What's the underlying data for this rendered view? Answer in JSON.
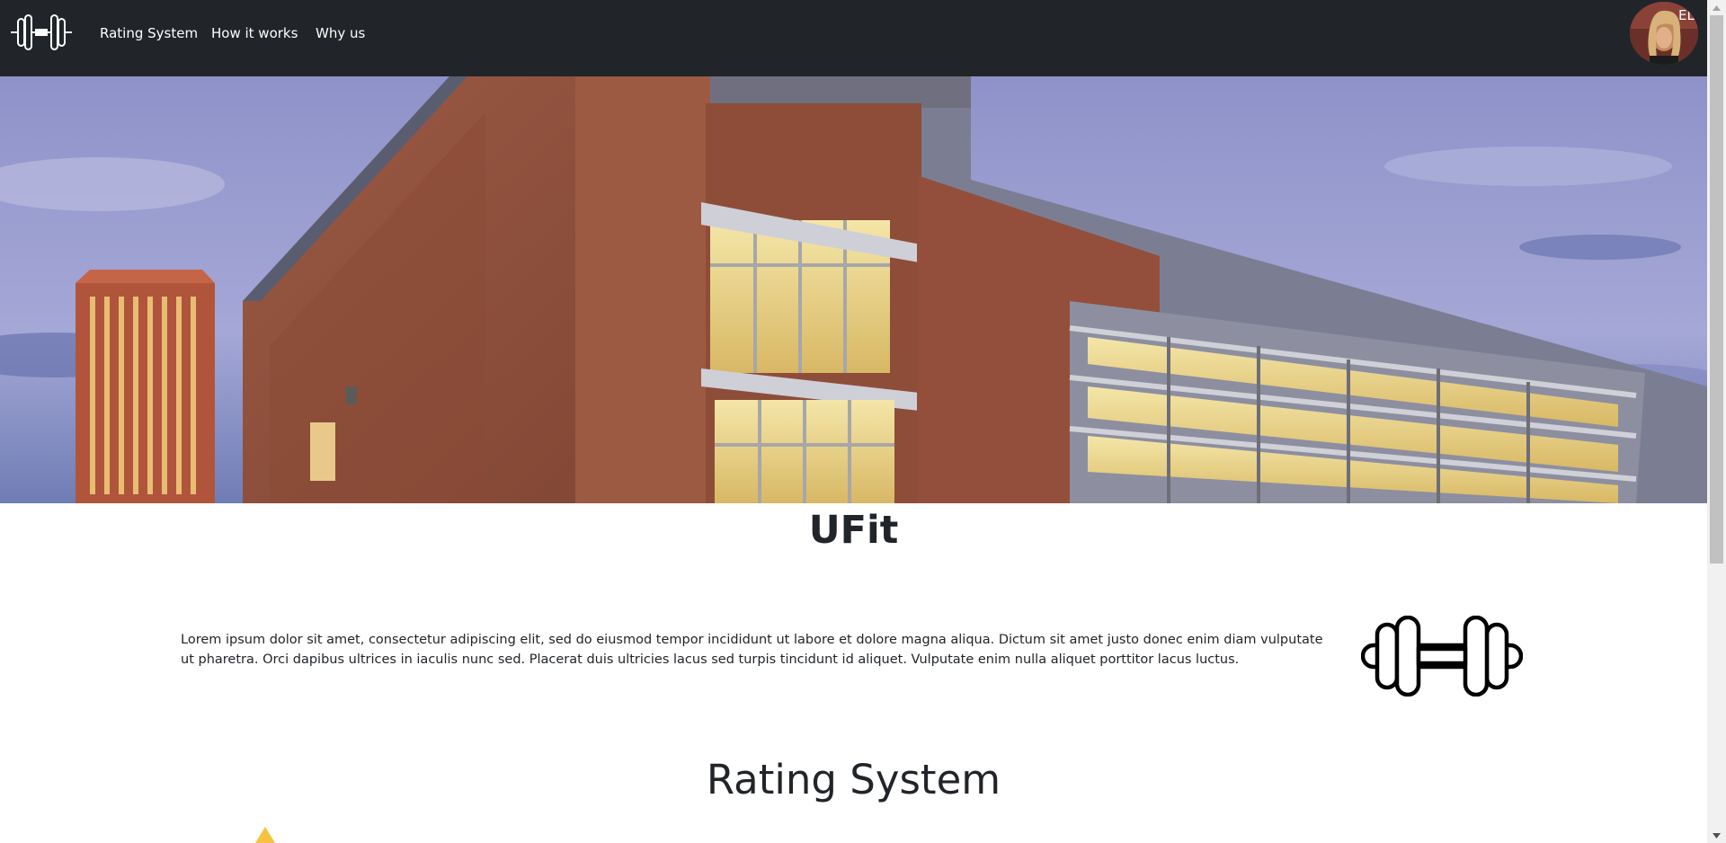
{
  "nav": {
    "brand_icon": "dumbbell-icon",
    "links": [
      "Rating System",
      "How it works",
      "Why us"
    ],
    "avatar": "user-avatar"
  },
  "hero": {
    "image": "university-recreation-building-photo"
  },
  "main": {
    "title": "UFit",
    "intro": "Lorem ipsum dolor sit amet, consectetur adipiscing elit, sed do eiusmod tempor incididunt ut labore et dolore magna aliqua. Dictum sit amet justo donec enim diam vulputate ut pharetra. Orci dapibus ultrices in iaculis nunc sed. Placerat duis ultricies lacus sed turpis tincidunt id aliquet. Vulputate enim nulla aliquet porttitor lacus luctus.",
    "intro_icon": "dumbbell-icon",
    "section_title": "Rating System",
    "star_icon": "star-icon"
  },
  "colors": {
    "navbar_bg": "#212529",
    "nav_text": "#ffffff",
    "body_text": "#212529",
    "star": "#f5c242"
  }
}
